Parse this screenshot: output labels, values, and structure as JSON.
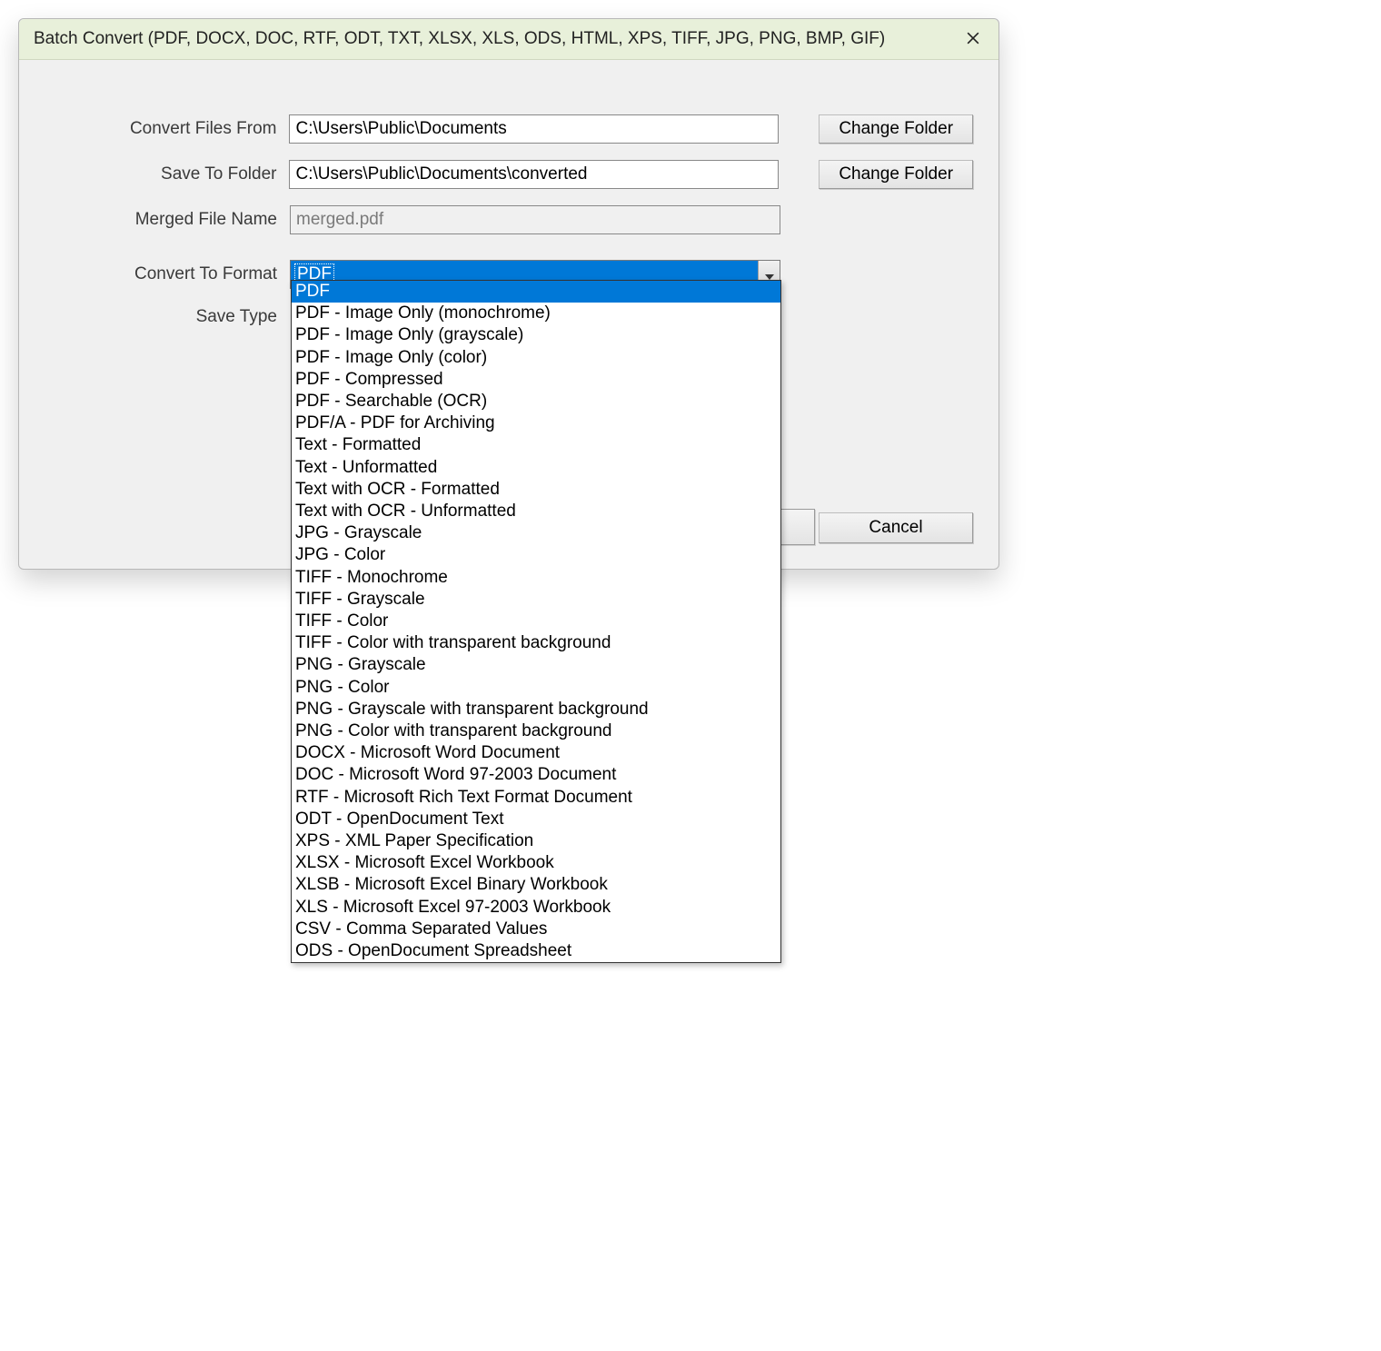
{
  "window": {
    "title": "Batch Convert (PDF, DOCX, DOC, RTF, ODT, TXT, XLSX, XLS, ODS, HTML, XPS, TIFF, JPG, PNG, BMP, GIF)"
  },
  "labels": {
    "convert_from": "Convert Files From",
    "save_to": "Save To Folder",
    "merged_name": "Merged File Name",
    "convert_format": "Convert To Format",
    "save_type": "Save Type"
  },
  "fields": {
    "convert_from_value": "C:\\Users\\Public\\Documents",
    "save_to_value": "C:\\Users\\Public\\Documents\\converted",
    "merged_name_value": "merged.pdf",
    "format_selected": "PDF"
  },
  "buttons": {
    "change_folder": "Change Folder",
    "cancel": "Cancel"
  },
  "format_options": [
    "PDF",
    "PDF - Image Only (monochrome)",
    "PDF - Image Only (grayscale)",
    "PDF - Image Only (color)",
    "PDF - Compressed",
    "PDF - Searchable (OCR)",
    "PDF/A - PDF for Archiving",
    "Text - Formatted",
    "Text - Unformatted",
    "Text with OCR - Formatted",
    "Text with OCR - Unformatted",
    "JPG - Grayscale",
    "JPG - Color",
    "TIFF - Monochrome",
    "TIFF - Grayscale",
    "TIFF - Color",
    "TIFF - Color with transparent background",
    "PNG - Grayscale",
    "PNG - Color",
    "PNG - Grayscale with transparent background",
    "PNG - Color with transparent background",
    "DOCX - Microsoft Word Document",
    "DOC - Microsoft Word 97-2003 Document",
    "RTF - Microsoft Rich Text Format Document",
    "ODT - OpenDocument Text",
    "XPS - XML Paper Specification",
    "XLSX - Microsoft Excel Workbook",
    "XLSB - Microsoft Excel Binary Workbook",
    "XLS - Microsoft Excel 97-2003 Workbook",
    "CSV - Comma Separated Values",
    "ODS - OpenDocument Spreadsheet"
  ]
}
